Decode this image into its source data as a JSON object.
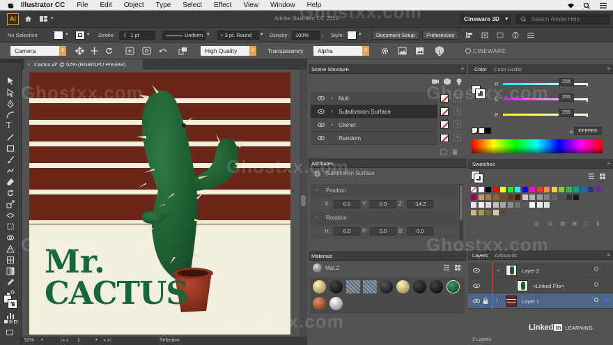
{
  "menubar": {
    "app_name": "Illustrator CC",
    "items": [
      "File",
      "Edit",
      "Object",
      "Type",
      "Select",
      "Effect",
      "View",
      "Window",
      "Help"
    ]
  },
  "appbar": {
    "title": "Adobe Illustrator CC 2019",
    "workspace": "Cineware 3D",
    "search_placeholder": "Search Adobe Help"
  },
  "control": {
    "selection": "No Selection",
    "stroke_label": "Stroke:",
    "stroke_value": "1 pt",
    "profile": "Uniform",
    "brush": "3 pt. Round",
    "opacity_label": "Opacity:",
    "opacity_value": "100%",
    "style_label": "Style:",
    "doc_setup": "Document Setup",
    "preferences": "Preferences"
  },
  "cineware": {
    "camera": "Camera",
    "quality": "High Quality",
    "transparency_label": "Transparency",
    "transparency_value": "Alpha",
    "logo": "CINEWARE"
  },
  "document": {
    "tab": "Cactus.ai* @ 52% (RGB/GPU Preview)",
    "zoom": "52%",
    "page": "1",
    "status_tool": "Selection",
    "art_line1": "Mr.",
    "art_line2": "CACTUS"
  },
  "scene": {
    "panel_title": "Scene Structure",
    "items": [
      {
        "name": "Null",
        "expandable": true,
        "selected": false
      },
      {
        "name": "Subdivision Surface",
        "expandable": true,
        "selected": true
      },
      {
        "name": "Cloner",
        "expandable": true,
        "selected": false
      },
      {
        "name": "Random",
        "expandable": false,
        "selected": false
      }
    ]
  },
  "attributes": {
    "panel_title": "Attributes",
    "object": "Subdivision Surface",
    "position": {
      "label": "Position",
      "x": "0.0",
      "y": "0.0",
      "z": "-14.2"
    },
    "rotation": {
      "label": "Rotation",
      "h": "0.0",
      "p": "0.0",
      "b": "0.0"
    }
  },
  "materials": {
    "panel_title": "Materials",
    "current": "Mat.2"
  },
  "color": {
    "tab1": "Color",
    "tab2": "Color Guide",
    "r": "255",
    "g": "255",
    "b": "255",
    "hex": "FFFFFF"
  },
  "swatches": {
    "panel_title": "Swatches"
  },
  "layers": {
    "tab1": "Layers",
    "tab2": "Artboards",
    "items": [
      {
        "name": "Layer 2"
      },
      {
        "name": "<Linked File>"
      },
      {
        "name": "Layer 1"
      }
    ],
    "count": "2 Layers"
  },
  "branding": {
    "linkedin": "Linked",
    "learning": "LEARNING",
    "watermark": "Ghostxx.com"
  }
}
